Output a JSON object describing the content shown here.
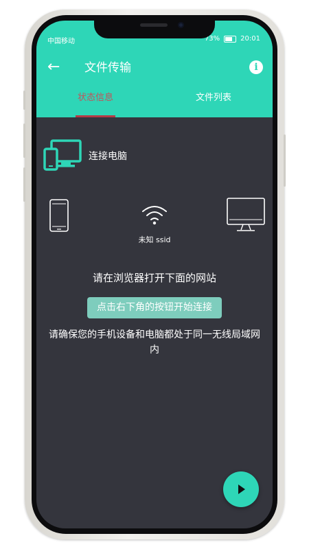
{
  "status_bar": {
    "carrier": "中国移动",
    "battery": "73%",
    "time": "20:01"
  },
  "app_bar": {
    "back_icon": "arrow-left-icon",
    "title": "文件传输",
    "info_icon": "info-icon"
  },
  "tabs": [
    {
      "label": "状态信息",
      "selected": true
    },
    {
      "label": "文件列表",
      "selected": false
    }
  ],
  "main": {
    "connect_label": "连接电脑",
    "ssid": "未知 ssid",
    "instruction": "请在浏览器打开下面的网站",
    "hint": "点击右下角的按钮开始连接",
    "notice": "请确保您的手机设备和电脑都处于同一无线局域网内"
  },
  "fab": {
    "icon": "play-icon"
  },
  "colors": {
    "accent": "#2ed6b7",
    "background": "#34353d",
    "tab_indicator": "#b53b45",
    "hint_chip": "#7ecdbd"
  }
}
